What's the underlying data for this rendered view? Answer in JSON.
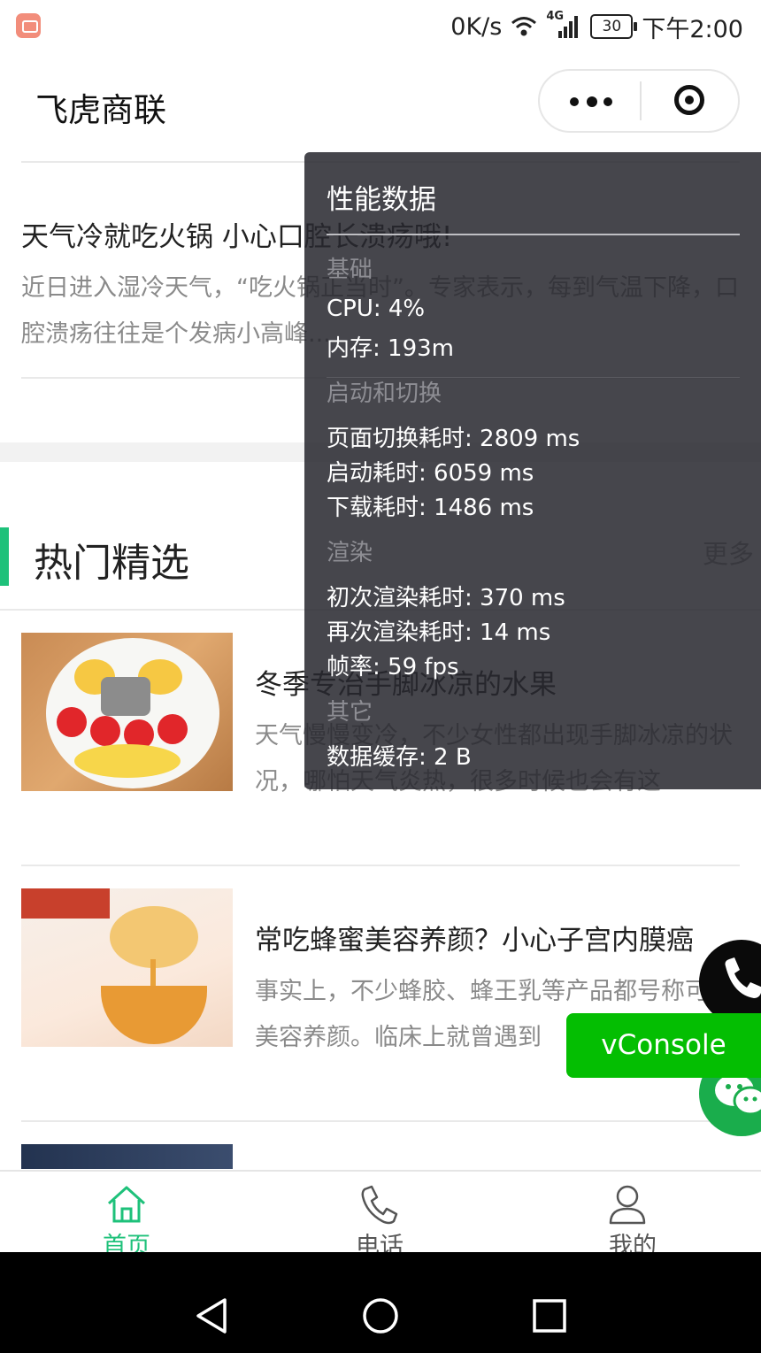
{
  "status_bar": {
    "speed": "0K/s",
    "network": "4G",
    "battery": "30",
    "time": "下午2:00"
  },
  "nav": {
    "title": "飞虎商联"
  },
  "article": {
    "title": "天气冷就吃火锅 小心口腔长溃疡哦!",
    "desc": "近日进入湿冷天气，“吃火锅正当时”。专家表示，每到气温下降，口腔溃疡往往是个发病小高峰..."
  },
  "section": {
    "title": "热门精选",
    "more": "更多"
  },
  "items": [
    {
      "title": "冬季专治手脚冰凉的水果",
      "desc": "天气慢慢变冷，不少女性都出现手脚冰凉的状况，哪怕天气炎热，很多时候也会有这"
    },
    {
      "title": "常吃蜂蜜美容养颜？小心子宫内膜癌",
      "desc": "事实上，不少蜂胶、蜂王乳等产品都号称可以美容养颜。临床上就曾遇到"
    }
  ],
  "perf": {
    "title": "性能数据",
    "cat_basic": "基础",
    "cpu": "CPU: 4%",
    "memory": "内存: 193m",
    "cat_launch": "启动和切换",
    "page_switch": "页面切换耗时: 2809 ms",
    "launch": "启动耗时: 6059 ms",
    "download": "下载耗时: 1486 ms",
    "cat_render": "渲染",
    "first_render": "初次渲染耗时: 370 ms",
    "re_render": "再次渲染耗时: 14 ms",
    "fps": "帧率: 59 fps",
    "cat_other": "其它",
    "cache": "数据缓存: 2 B"
  },
  "vconsole": "vConsole",
  "tabs": [
    {
      "label": "首页",
      "icon": "home-icon",
      "active": true
    },
    {
      "label": "电话",
      "icon": "phone-icon",
      "active": false
    },
    {
      "label": "我的",
      "icon": "user-icon",
      "active": false
    }
  ],
  "colors": {
    "accent": "#1ec17a",
    "vconsole": "#04be02",
    "wechat": "#1aad4c",
    "tab_inactive": "#555555"
  }
}
